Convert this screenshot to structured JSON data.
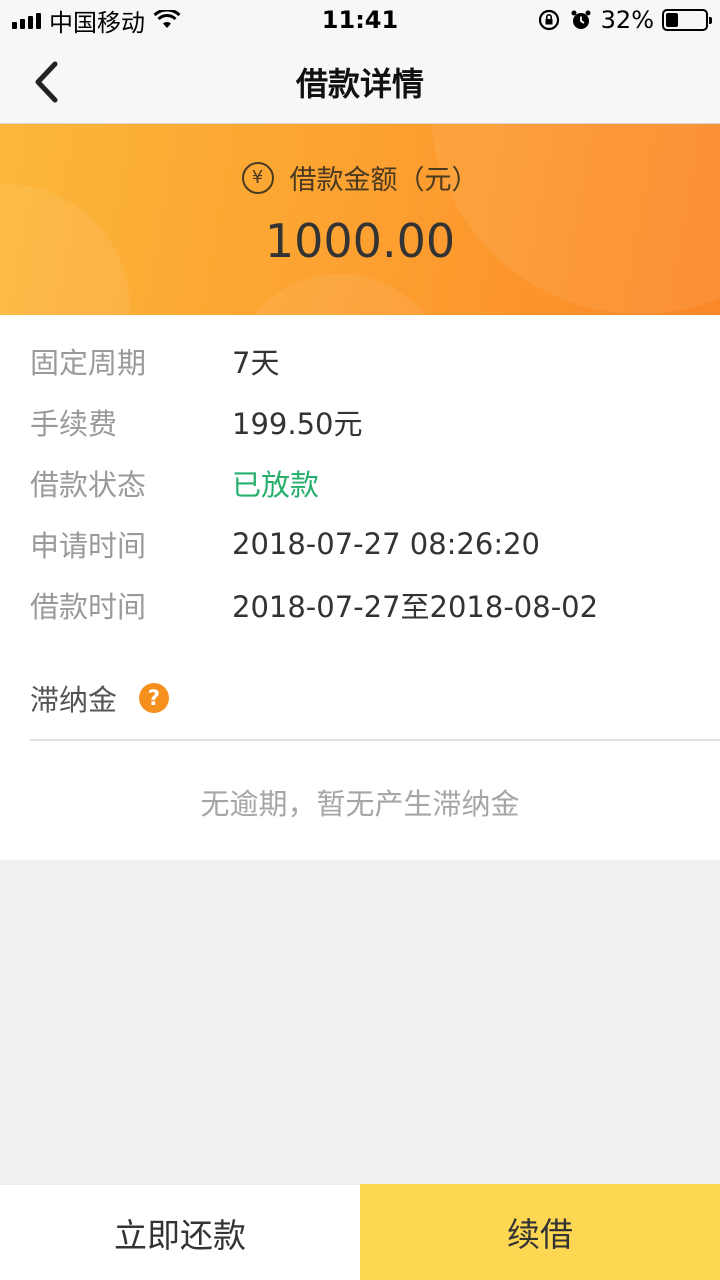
{
  "status_bar": {
    "carrier": "中国移动",
    "time": "11:41",
    "battery": "32%",
    "battery_level": 0.32
  },
  "nav": {
    "title": "借款详情",
    "back_icon": "chevron-left-icon"
  },
  "banner": {
    "label": "借款金额（元）",
    "currency_symbol": "¥",
    "amount": "1000.00"
  },
  "details": {
    "rows": [
      {
        "label": "固定周期",
        "value": "7天"
      },
      {
        "label": "手续费",
        "value": "199.50元"
      },
      {
        "label": "借款状态",
        "value": "已放款"
      },
      {
        "label": "申请时间",
        "value": "2018-07-27 08:26:20"
      },
      {
        "label": "借款时间",
        "value": "2018-07-27至2018-08-02"
      }
    ],
    "status_color": "#27b06c"
  },
  "late_fee": {
    "label": "滞纳金",
    "help_symbol": "?",
    "note": "无逾期，暂无产生滞纳金"
  },
  "actions": {
    "repay_label": "立即还款",
    "renew_label": "续借",
    "renew_color": "#fdd751"
  }
}
